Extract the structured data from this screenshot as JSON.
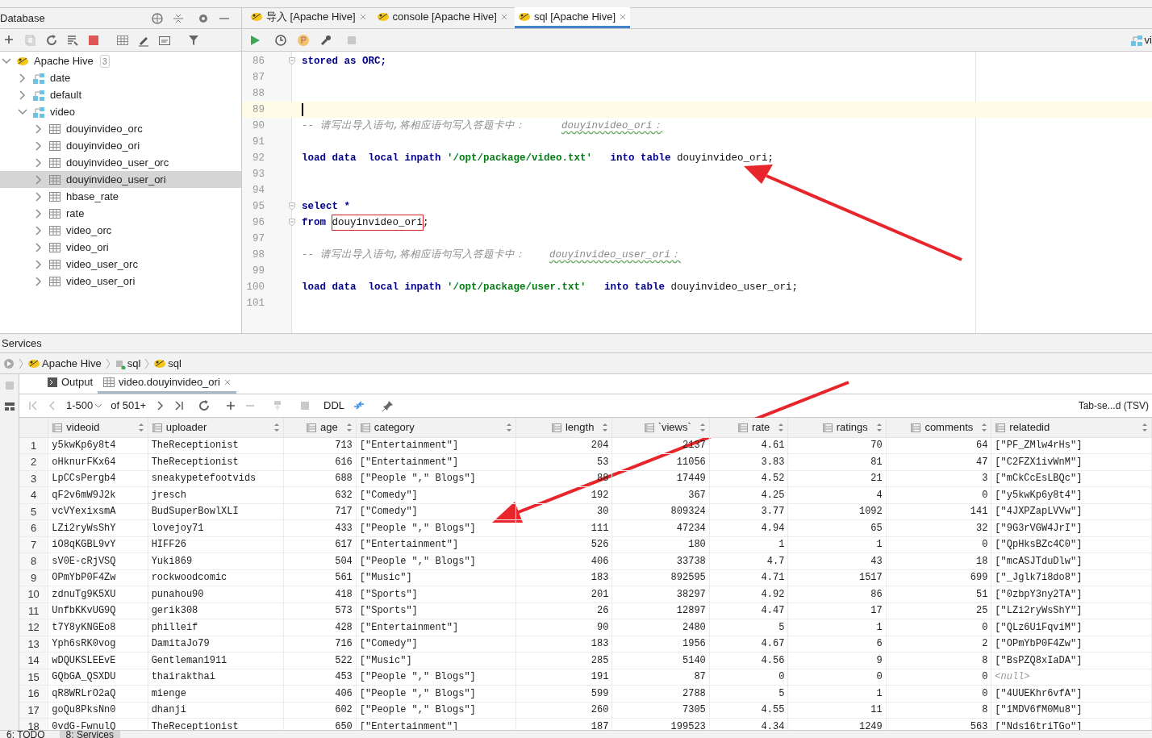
{
  "database_panel": {
    "title": "Database",
    "tree": [
      {
        "label": "Apache Hive",
        "kind": "datasource",
        "badge": "3",
        "expanded": true,
        "selected": false,
        "children": [
          {
            "label": "date",
            "kind": "schema",
            "expanded": false,
            "selected": false
          },
          {
            "label": "default",
            "kind": "schema",
            "expanded": false,
            "selected": false
          },
          {
            "label": "video",
            "kind": "schema",
            "expanded": true,
            "selected": false,
            "children": [
              {
                "label": "douyinvideo_orc",
                "kind": "table",
                "expanded": false,
                "selected": false
              },
              {
                "label": "douyinvideo_ori",
                "kind": "table",
                "expanded": false,
                "selected": false
              },
              {
                "label": "douyinvideo_user_orc",
                "kind": "table",
                "expanded": false,
                "selected": false
              },
              {
                "label": "douyinvideo_user_ori",
                "kind": "table",
                "expanded": false,
                "selected": true
              },
              {
                "label": "hbase_rate",
                "kind": "table",
                "expanded": false,
                "selected": false
              },
              {
                "label": "rate",
                "kind": "table",
                "expanded": false,
                "selected": false
              },
              {
                "label": "video_orc",
                "kind": "table",
                "expanded": false,
                "selected": false
              },
              {
                "label": "video_ori",
                "kind": "table",
                "expanded": false,
                "selected": false
              },
              {
                "label": "video_user_orc",
                "kind": "table",
                "expanded": false,
                "selected": false
              },
              {
                "label": "video_user_ori",
                "kind": "table",
                "expanded": false,
                "selected": false
              }
            ]
          }
        ]
      }
    ]
  },
  "editor": {
    "tabs": [
      {
        "label": "导入 [Apache Hive]",
        "selected": false
      },
      {
        "label": "console [Apache Hive]",
        "selected": false
      },
      {
        "label": "sql [Apache Hive]",
        "selected": true
      }
    ],
    "schema_label": "vi",
    "lines": [
      {
        "number": "86",
        "fold": true,
        "current": false,
        "segments": [
          {
            "kind": "keyword",
            "text": "stored as ORC;"
          }
        ]
      },
      {
        "number": "87",
        "fold": false,
        "current": false
      },
      {
        "number": "88",
        "fold": false,
        "current": false
      },
      {
        "number": "89",
        "fold": false,
        "current": true
      },
      {
        "number": "90",
        "fold": false,
        "current": false,
        "segments": [
          {
            "kind": "comment",
            "text": "-- 请写出导入语句,将相应语句写入答题卡中：      "
          },
          {
            "kind": "comment_ident",
            "text": "douyinvideo_ori："
          }
        ]
      },
      {
        "number": "91",
        "fold": false,
        "current": false
      },
      {
        "number": "92",
        "fold": false,
        "current": false,
        "segments": [
          {
            "kind": "keyword",
            "text": "load data  local inpath "
          },
          {
            "kind": "string",
            "text": "'/opt/package/video.txt'"
          },
          {
            "kind": "keyword",
            "text": "   into table "
          },
          {
            "kind": "plain",
            "text": "douyinvideo_ori;"
          }
        ]
      },
      {
        "number": "93",
        "fold": false,
        "current": false
      },
      {
        "number": "94",
        "fold": false,
        "current": false
      },
      {
        "number": "95",
        "fold": true,
        "current": false,
        "segments": [
          {
            "kind": "keyword",
            "text": "select *"
          }
        ]
      },
      {
        "number": "96",
        "fold": true,
        "current": false,
        "segments": [
          {
            "kind": "keyword",
            "text": "from "
          },
          {
            "kind": "boxed",
            "text": "douyinvideo_ori"
          },
          {
            "kind": "plain",
            "text": ";"
          }
        ]
      },
      {
        "number": "97",
        "fold": false,
        "current": false
      },
      {
        "number": "98",
        "fold": false,
        "current": false,
        "segments": [
          {
            "kind": "comment",
            "text": "-- 请写出导入语句,将相应语句写入答题卡中：    "
          },
          {
            "kind": "comment_ident",
            "text": "douyinvideo_user_ori："
          }
        ]
      },
      {
        "number": "99",
        "fold": false,
        "current": false
      },
      {
        "number": "100",
        "fold": false,
        "current": false,
        "segments": [
          {
            "kind": "keyword",
            "text": "load data  local inpath "
          },
          {
            "kind": "string",
            "text": "'/opt/package/user.txt'"
          },
          {
            "kind": "keyword",
            "text": "   into table "
          },
          {
            "kind": "plain",
            "text": "douyinvideo_user_ori;"
          }
        ]
      },
      {
        "number": "101",
        "fold": false,
        "current": false
      }
    ]
  },
  "services": {
    "title": "Services",
    "breadcrumb": [
      "Apache Hive",
      "sql",
      "sql"
    ],
    "tabs": [
      {
        "label": "Output",
        "kind": "output",
        "selected": false
      },
      {
        "label": "video.douyinvideo_ori",
        "kind": "table",
        "selected": true
      }
    ],
    "page_range": "1-500",
    "page_total": "of 501+",
    "ddl": "DDL",
    "format": "Tab-se...d (TSV)",
    "columns": [
      {
        "name": "videoid",
        "kind": "text"
      },
      {
        "name": "uploader",
        "kind": "text"
      },
      {
        "name": "age",
        "kind": "number"
      },
      {
        "name": "category",
        "kind": "text"
      },
      {
        "name": "length",
        "kind": "number"
      },
      {
        "name": "`views`",
        "kind": "number"
      },
      {
        "name": "rate",
        "kind": "number"
      },
      {
        "name": "ratings",
        "kind": "number"
      },
      {
        "name": "comments",
        "kind": "number"
      },
      {
        "name": "relatedid",
        "kind": "text"
      }
    ],
    "rows": [
      {
        "number": "1",
        "cells": [
          "y5kwKp6y8t4",
          "TheReceptionist",
          "713",
          "[\"Entertainment\"]",
          "204",
          "2137",
          "4.61",
          "70",
          "64",
          "[\"PF_ZMlw4rHs\"]"
        ]
      },
      {
        "number": "2",
        "cells": [
          "oHknurFKx64",
          "TheReceptionist",
          "616",
          "[\"Entertainment\"]",
          "53",
          "11056",
          "3.83",
          "81",
          "47",
          "[\"C2FZX1ivWnM\"]"
        ]
      },
      {
        "number": "3",
        "cells": [
          "LpCCsPergb4",
          "sneakypetefootvids",
          "688",
          "[\"People \",\" Blogs\"]",
          "88",
          "17449",
          "4.52",
          "21",
          "3",
          "[\"mCkCcEsLBQc\"]"
        ]
      },
      {
        "number": "4",
        "cells": [
          "qF2v6mW9J2k",
          "jresch",
          "632",
          "[\"Comedy\"]",
          "192",
          "367",
          "4.25",
          "4",
          "0",
          "[\"y5kwKp6y8t4\"]"
        ]
      },
      {
        "number": "5",
        "cells": [
          "vcVYexixsmA",
          "BudSuperBowlXLI",
          "717",
          "[\"Comedy\"]",
          "30",
          "809324",
          "3.77",
          "1092",
          "141",
          "[\"4JXPZapLVVw\"]"
        ]
      },
      {
        "number": "6",
        "cells": [
          "LZi2ryWsShY",
          "lovejoy71",
          "433",
          "[\"People \",\" Blogs\"]",
          "111",
          "47234",
          "4.94",
          "65",
          "32",
          "[\"9G3rVGW4JrI\"]"
        ]
      },
      {
        "number": "7",
        "cells": [
          "iO8qKGBL9vY",
          "HIFF26",
          "617",
          "[\"Entertainment\"]",
          "526",
          "180",
          "1",
          "1",
          "0",
          "[\"QpHksBZc4C0\"]"
        ]
      },
      {
        "number": "8",
        "cells": [
          "sV0E-cRjVSQ",
          "Yuki869",
          "504",
          "[\"People \",\" Blogs\"]",
          "406",
          "33738",
          "4.7",
          "43",
          "18",
          "[\"mcASJTduDlw\"]"
        ]
      },
      {
        "number": "9",
        "cells": [
          "OPmYbP0F4Zw",
          "rockwoodcomic",
          "561",
          "[\"Music\"]",
          "183",
          "892595",
          "4.71",
          "1517",
          "699",
          "[\"_Jglk7i8do8\"]"
        ]
      },
      {
        "number": "10",
        "cells": [
          "zdnuTg9K5XU",
          "punahou90",
          "418",
          "[\"Sports\"]",
          "201",
          "38297",
          "4.92",
          "86",
          "51",
          "[\"0zbpY3ny2TA\"]"
        ]
      },
      {
        "number": "11",
        "cells": [
          "UnfbKKvUG9Q",
          "gerik308",
          "573",
          "[\"Sports\"]",
          "26",
          "12897",
          "4.47",
          "17",
          "25",
          "[\"LZi2ryWsShY\"]"
        ]
      },
      {
        "number": "12",
        "cells": [
          "t7Y8yKNGEo8",
          "philleif",
          "428",
          "[\"Entertainment\"]",
          "90",
          "2480",
          "5",
          "1",
          "0",
          "[\"QLz6U1FqviM\"]"
        ]
      },
      {
        "number": "13",
        "cells": [
          "Yph6sRK0vog",
          "DamitaJo79",
          "716",
          "[\"Comedy\"]",
          "183",
          "1956",
          "4.67",
          "6",
          "2",
          "[\"OPmYbP0F4Zw\"]"
        ]
      },
      {
        "number": "14",
        "cells": [
          "wDQUKSLEEvE",
          "Gentleman1911",
          "522",
          "[\"Music\"]",
          "285",
          "5140",
          "4.56",
          "9",
          "8",
          "[\"BsPZQ8xIaDA\"]"
        ]
      },
      {
        "number": "15",
        "cells": [
          "GQbGA_QSXDU",
          "thairakthai",
          "453",
          "[\"People \",\" Blogs\"]",
          "191",
          "87",
          "0",
          "0",
          "0",
          {
            "kind": "null",
            "text": "<null>"
          }
        ]
      },
      {
        "number": "16",
        "cells": [
          "qR8WRLrO2aQ",
          "mienge",
          "406",
          "[\"People \",\" Blogs\"]",
          "599",
          "2788",
          "5",
          "1",
          "0",
          "[\"4UUEKhr6vfA\"]"
        ]
      },
      {
        "number": "17",
        "cells": [
          "goQu8PksNn0",
          "dhanji",
          "602",
          "[\"People \",\" Blogs\"]",
          "260",
          "7305",
          "4.55",
          "11",
          "8",
          "[\"1MDV6fM0Mu8\"]"
        ]
      },
      {
        "number": "18",
        "cells": [
          "0vdG-FwnulQ",
          "TheReceptionist",
          "650",
          "[\"Entertainment\"]",
          "187",
          "199523",
          "4.34",
          "1249",
          "563",
          "[\"Nds16triTGo\"]"
        ]
      }
    ]
  },
  "status_bar": [
    {
      "label": "6: TODO",
      "selected": false
    },
    {
      "label": "8: Services",
      "selected": true
    }
  ]
}
